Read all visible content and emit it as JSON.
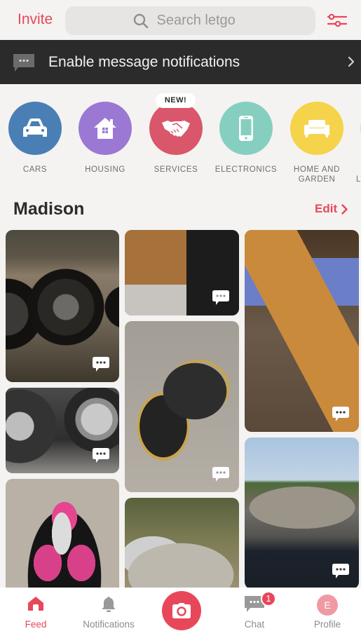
{
  "header": {
    "invite_label": "Invite",
    "search_placeholder": "Search letgo",
    "search_icon": "search-icon",
    "filter_icon": "sliders-icon"
  },
  "banner": {
    "icon": "message-bubble-icon",
    "text": "Enable message notifications",
    "chevron": "chevron-right-icon"
  },
  "categories": {
    "new_badge": "NEW!",
    "items": [
      {
        "label": "CARS",
        "icon": "car-icon",
        "color": "#4a7fb5"
      },
      {
        "label": "HOUSING",
        "icon": "house-icon",
        "color": "#9b78d3"
      },
      {
        "label": "SERVICES",
        "icon": "handshake-icon",
        "color": "#d9566b"
      },
      {
        "label": "ELECTRONICS",
        "icon": "phone-icon",
        "color": "#86cfc0"
      },
      {
        "label": "HOME AND GARDEN",
        "icon": "sofa-icon",
        "color": "#f5d34a"
      },
      {
        "label": "L",
        "icon": "partial-category-icon",
        "color": "#dcdad8"
      }
    ]
  },
  "section": {
    "title": "Madison",
    "edit_label": "Edit"
  },
  "listings": [
    {
      "name": "chrome-rims",
      "column": 1
    },
    {
      "name": "hubcap-tires",
      "column": 1
    },
    {
      "name": "pink-bike-helmet",
      "column": 1
    },
    {
      "name": "wooden-tv-stand",
      "column": 2
    },
    {
      "name": "hockey-helmet",
      "column": 2
    },
    {
      "name": "silver-sedan",
      "column": 2
    },
    {
      "name": "license-plates",
      "column": 3
    },
    {
      "name": "gray-ford-focus",
      "column": 3
    }
  ],
  "tabbar": {
    "feed": "Feed",
    "notifications": "Notifications",
    "chat": "Chat",
    "chat_badge": "1",
    "profile": "Profile",
    "profile_initial": "E"
  },
  "colors": {
    "accent": "#e8475a",
    "banner_bg": "#2b2b2b",
    "page_bg": "#f4f3f1"
  }
}
